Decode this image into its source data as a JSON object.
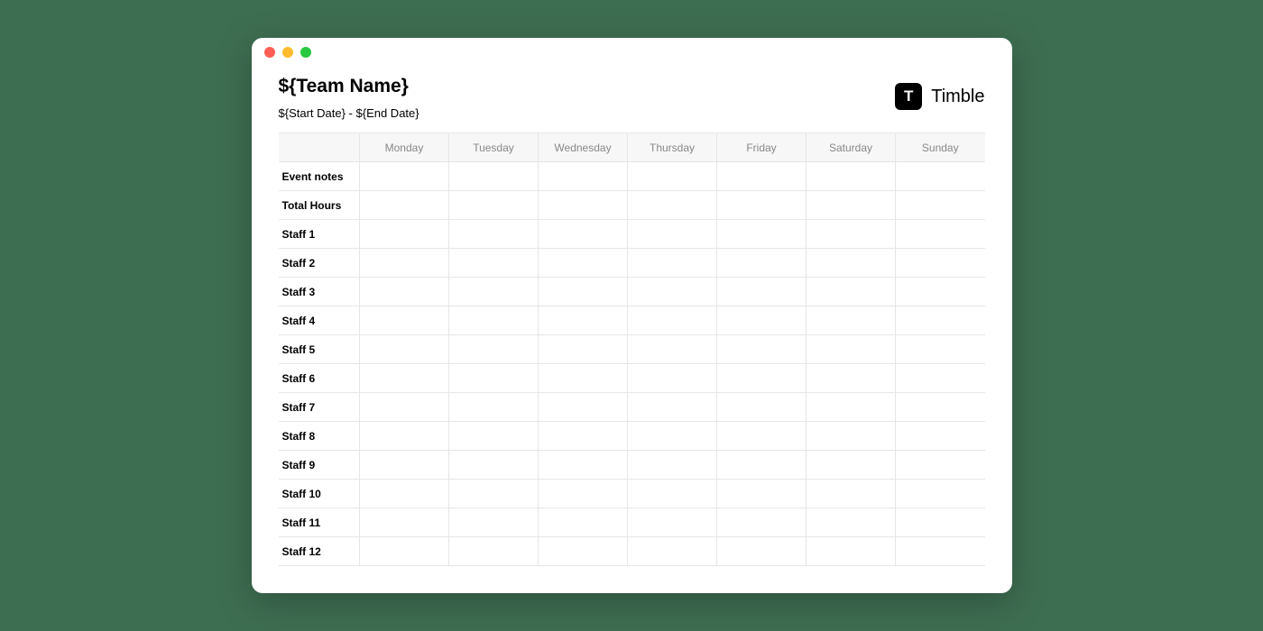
{
  "header": {
    "team_name": "${Team Name}",
    "date_range": "${Start Date} - ${End Date}"
  },
  "brand": {
    "logo_letter": "T",
    "name": "Timble"
  },
  "table": {
    "columns": [
      "Monday",
      "Tuesday",
      "Wednesday",
      "Thursday",
      "Friday",
      "Saturday",
      "Sunday"
    ],
    "rows": [
      {
        "label": "Event notes"
      },
      {
        "label": "Total Hours"
      },
      {
        "label": "Staff 1"
      },
      {
        "label": "Staff 2"
      },
      {
        "label": "Staff 3"
      },
      {
        "label": "Staff 4"
      },
      {
        "label": "Staff 5"
      },
      {
        "label": "Staff 6"
      },
      {
        "label": "Staff 7"
      },
      {
        "label": "Staff 8"
      },
      {
        "label": "Staff 9"
      },
      {
        "label": "Staff 10"
      },
      {
        "label": "Staff 11"
      },
      {
        "label": "Staff 12"
      }
    ]
  }
}
